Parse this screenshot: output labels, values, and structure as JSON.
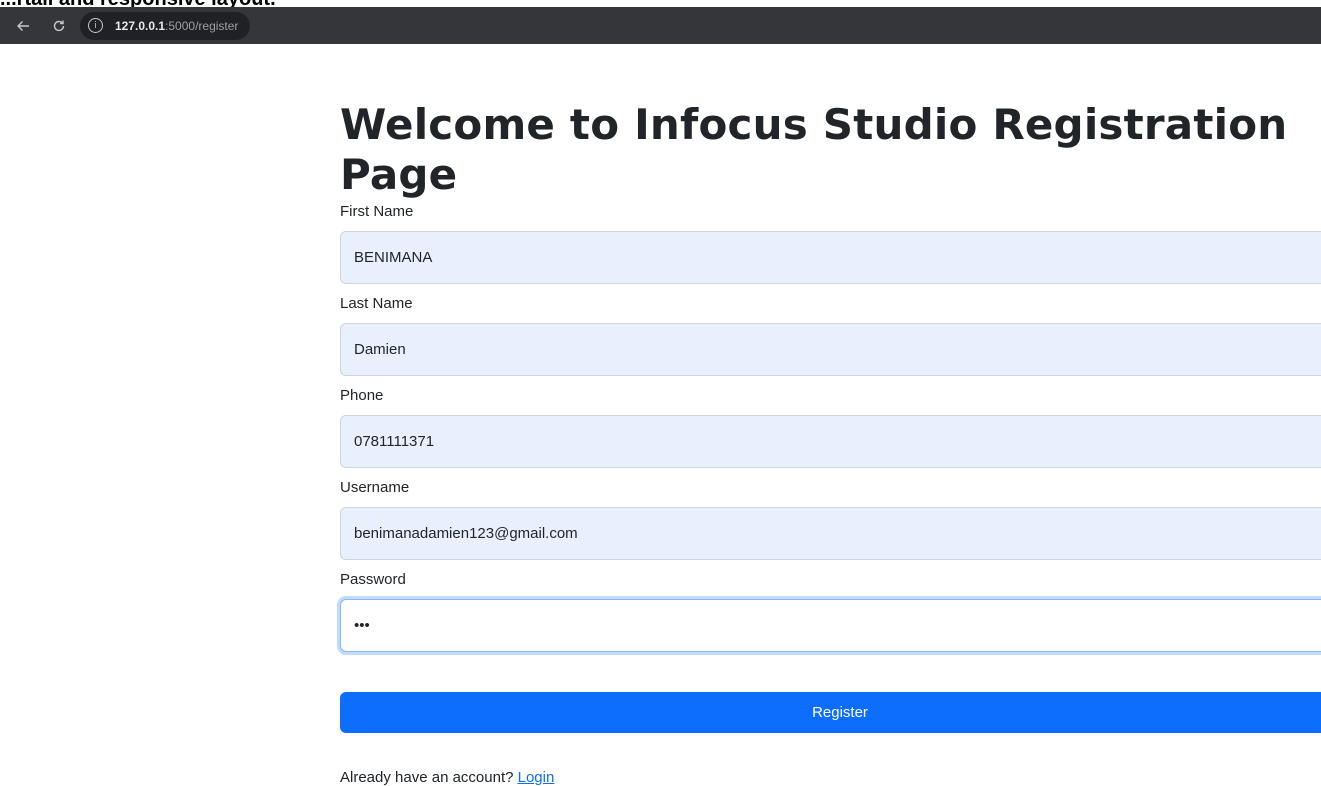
{
  "caption_fragment": "...rtail and responsive layout.",
  "browser": {
    "url_host": "127.0.0.1",
    "url_rest": ":5000/register"
  },
  "page": {
    "title": "Welcome to Infocus Studio Registration Page"
  },
  "form": {
    "first_name": {
      "label": "First Name",
      "value": "BENIMANA"
    },
    "last_name": {
      "label": "Last Name",
      "value": "Damien"
    },
    "phone": {
      "label": "Phone",
      "value": "0781111371"
    },
    "username": {
      "label": "Username",
      "value": "benimanadamien123@gmail.com"
    },
    "password": {
      "label": "Password",
      "value": "abc"
    },
    "submit_label": "Register"
  },
  "footer": {
    "prompt": "Already have an account?",
    "login_label": "Login"
  },
  "colors": {
    "primary": "#0d6efd",
    "autofill_bg": "#e8f0fe",
    "browser_bar": "#35363a"
  }
}
